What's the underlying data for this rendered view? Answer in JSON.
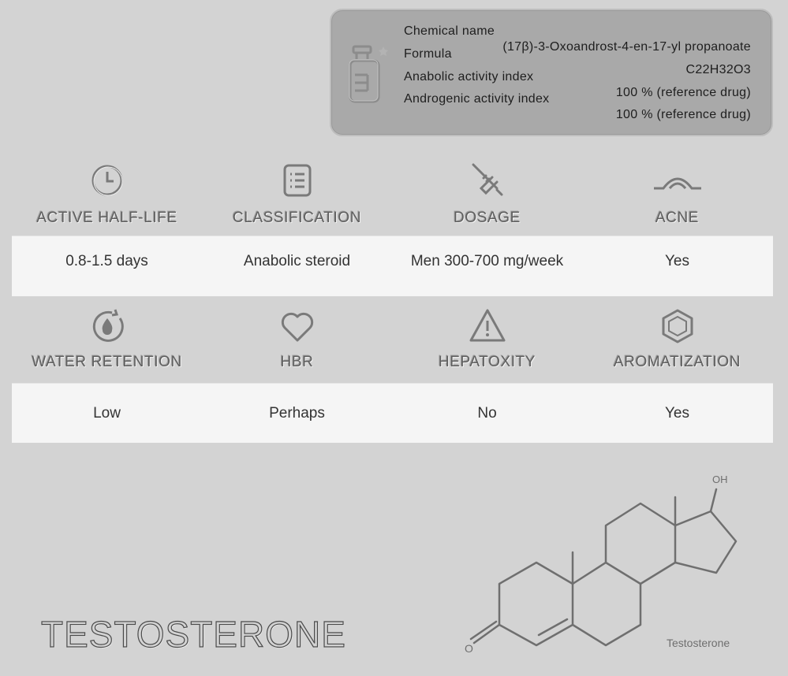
{
  "info": {
    "labels": {
      "chemical_name": "Chemical name",
      "formula": "Formula",
      "anabolic": "Anabolic activity index",
      "androgenic": "Androgenic activity index"
    },
    "values": {
      "chemical_name": "(17β)-3-Oxoandrost-4-en-17-yl propanoate",
      "formula": "C22H32O3",
      "anabolic": "100 % (reference drug)",
      "androgenic": "100 % (reference drug)"
    }
  },
  "row1": {
    "headers": [
      "ACTIVE HALF-LIFE",
      "CLASSIFICATION",
      "DOSAGE",
      "ACNE"
    ],
    "icons": [
      "clock-icon",
      "list-icon",
      "syringe-icon",
      "acne-icon"
    ],
    "values": [
      "0.8-1.5 days",
      "Anabolic steroid",
      "Men 300-700 mg/week",
      "Yes"
    ]
  },
  "row2": {
    "headers": [
      "WATER RETENTION",
      "HBR",
      "HEPATOXITY",
      "AROMATIZATION"
    ],
    "icons": [
      "water-drop-icon",
      "heart-icon",
      "warning-icon",
      "hexagon-icon"
    ],
    "values": [
      "Low",
      "Perhaps",
      "No",
      "Yes"
    ]
  },
  "title": "TESTOSTERONE",
  "molecule": {
    "oh_label": "OH",
    "o_label": "O",
    "caption": "Testosterone"
  }
}
